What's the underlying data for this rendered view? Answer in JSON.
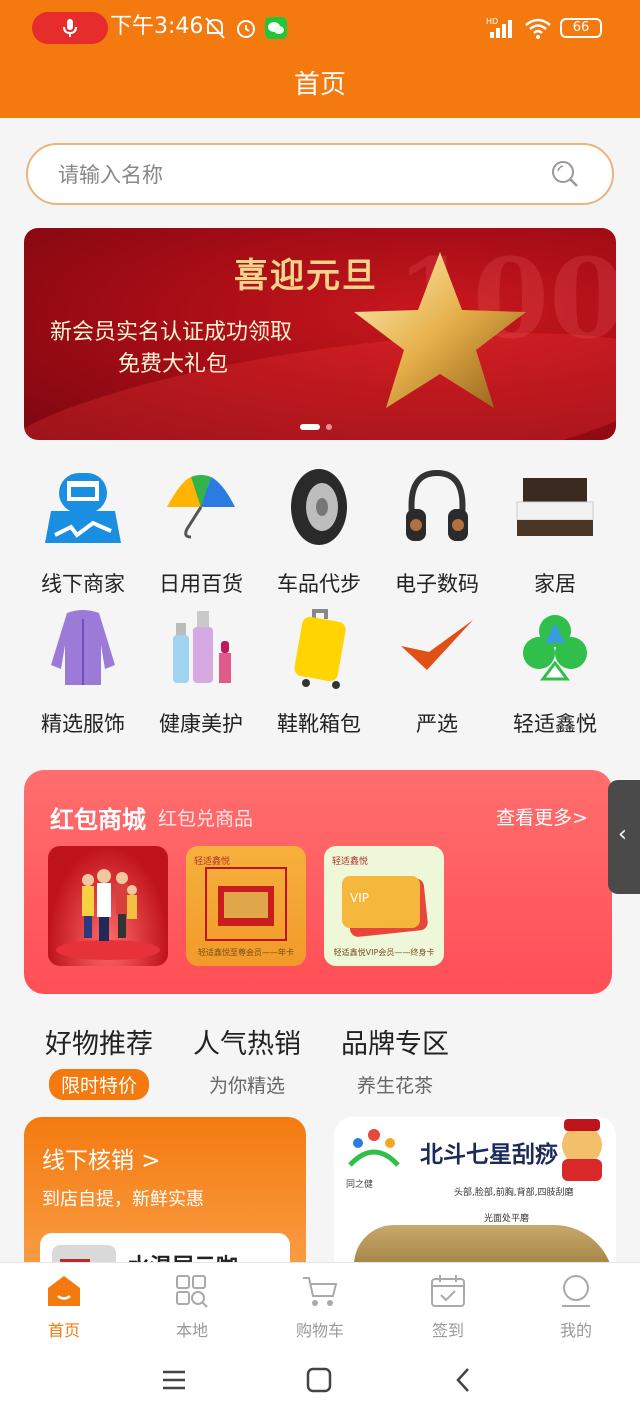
{
  "status_bar": {
    "time": "下午3:46",
    "battery": "66"
  },
  "header": {
    "title": "首页"
  },
  "search": {
    "placeholder": "请输入名称"
  },
  "banner": {
    "title": "喜迎元旦",
    "line1": "新会员实名认证成功领取",
    "line2": "免费大礼包",
    "big_number": "100"
  },
  "categories": [
    {
      "label": "线下商家",
      "icon": "shop-map-icon"
    },
    {
      "label": "日用百货",
      "icon": "umbrella-icon"
    },
    {
      "label": "车品代步",
      "icon": "tire-icon"
    },
    {
      "label": "电子数码",
      "icon": "headphones-icon"
    },
    {
      "label": "家居",
      "icon": "bed-icon"
    },
    {
      "label": "精选服饰",
      "icon": "jacket-icon"
    },
    {
      "label": "健康美护",
      "icon": "cosmetics-icon"
    },
    {
      "label": "鞋靴箱包",
      "icon": "suitcase-icon"
    },
    {
      "label": "严选",
      "icon": "checkmark-icon"
    },
    {
      "label": "轻适鑫悦",
      "icon": "clover-logo-icon"
    }
  ],
  "red_packet": {
    "title": "红包商城",
    "subtitle": "红包兑商品",
    "more": "查看更多>",
    "cards": [
      {
        "caption": ""
      },
      {
        "tag": "轻适鑫悦",
        "caption": "轻适鑫悦至尊会员——年卡"
      },
      {
        "tag": "轻适鑫悦",
        "caption": "轻适鑫悦VIP会员——终身卡"
      }
    ]
  },
  "tabs": [
    {
      "title": "好物推荐",
      "subtitle": "限时特价"
    },
    {
      "title": "人气热销",
      "subtitle": "为你精选"
    },
    {
      "title": "品牌专区",
      "subtitle": "养生花茶"
    }
  ],
  "offline": {
    "title": "线下核销 >",
    "subtitle": "到店自提，新鲜实惠",
    "item_name": "水温层云咖..."
  },
  "promo": {
    "brand": "同之健",
    "title": "北斗七星刮痧",
    "parts": "头部,脸部,前胸,背部,四肢刮磨",
    "face": "光面处平磨"
  },
  "bottom_nav": [
    {
      "label": "首页",
      "icon": "home-icon"
    },
    {
      "label": "本地",
      "icon": "local-grid-icon"
    },
    {
      "label": "购物车",
      "icon": "cart-icon"
    },
    {
      "label": "签到",
      "icon": "calendar-check-icon"
    },
    {
      "label": "我的",
      "icon": "user-icon"
    }
  ],
  "colors": {
    "primary": "#f47a10",
    "red": "#ff4f56"
  }
}
